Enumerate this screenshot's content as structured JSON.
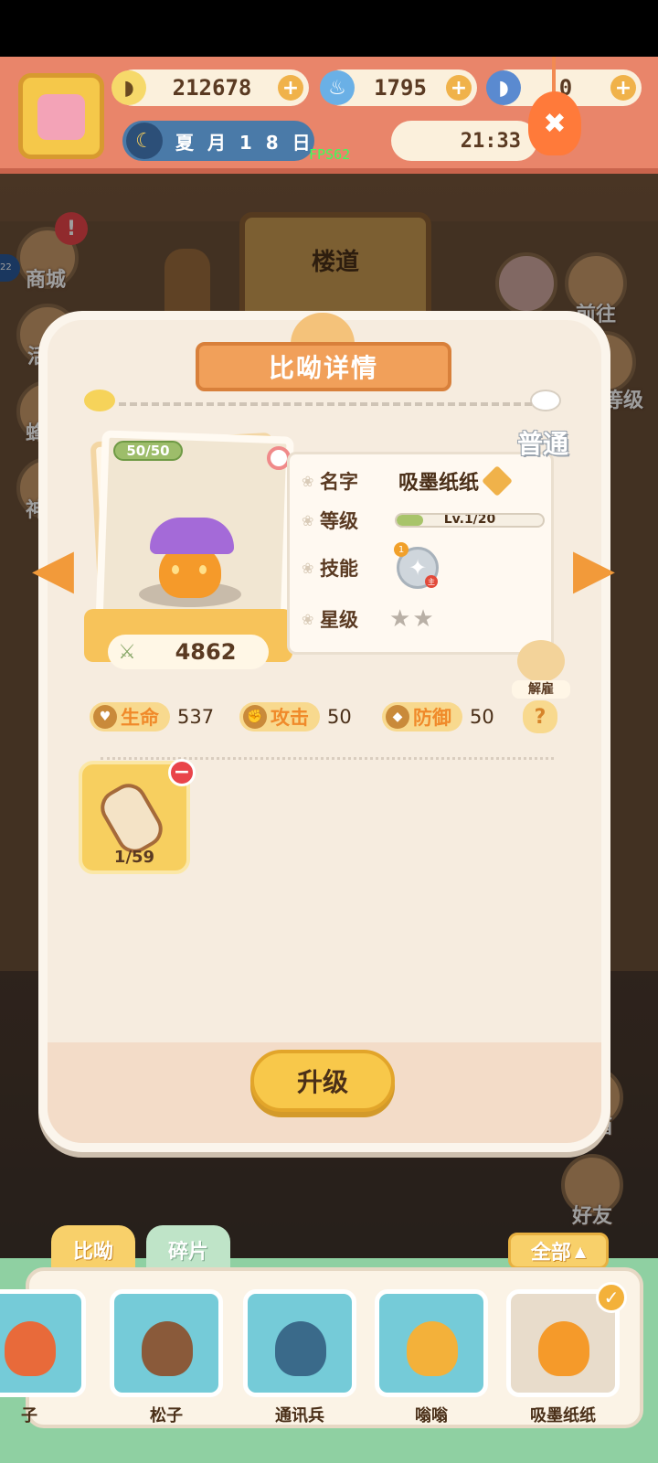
{
  "topbar": {
    "bananas": "212678",
    "flames": "1795",
    "blue_bananas": "0",
    "date": "夏 月 1 8 日",
    "fps": "FPS62",
    "time": "21:33"
  },
  "background": {
    "door_label": "楼道",
    "left_buttons": [
      "商城",
      "活",
      "蜂",
      "神"
    ],
    "left_badge": "22",
    "right_buttons": [
      "前往",
      "等级",
      "邮箱",
      "好友"
    ]
  },
  "dialog": {
    "title": "比呦详情",
    "rarity": "普通",
    "hp": "50/50",
    "power": "4862",
    "labels": {
      "name": "名字",
      "level": "等级",
      "skill": "技能",
      "star": "星级"
    },
    "pet_name": "吸墨纸纸",
    "level_text": "Lv.1/20",
    "level_fraction": 0.05,
    "skill_level": "1",
    "skill_tag": "主",
    "stars": 0,
    "stars_max": 2,
    "dismiss_label": "解雇",
    "stats": [
      {
        "name": "生命",
        "value": "537"
      },
      {
        "name": "攻击",
        "value": "50"
      },
      {
        "name": "防御",
        "value": "50"
      }
    ],
    "help": "?",
    "item_count": "1/59",
    "upgrade_label": "升级"
  },
  "bottom": {
    "tabs": [
      "比呦",
      "碎片"
    ],
    "filter_label": "全部",
    "pets": [
      {
        "name": "子",
        "color": "#e86a3a"
      },
      {
        "name": "松子",
        "color": "#8a5a3a"
      },
      {
        "name": "通讯兵",
        "color": "#3a6a8a"
      },
      {
        "name": "嗡嗡",
        "color": "#f3b13a"
      },
      {
        "name": "吸墨纸纸",
        "color": "#f59a2a"
      }
    ]
  },
  "colors": {
    "accent": "#f1a05a",
    "banner": "#e9856a",
    "upgrade": "#f8c84a"
  }
}
